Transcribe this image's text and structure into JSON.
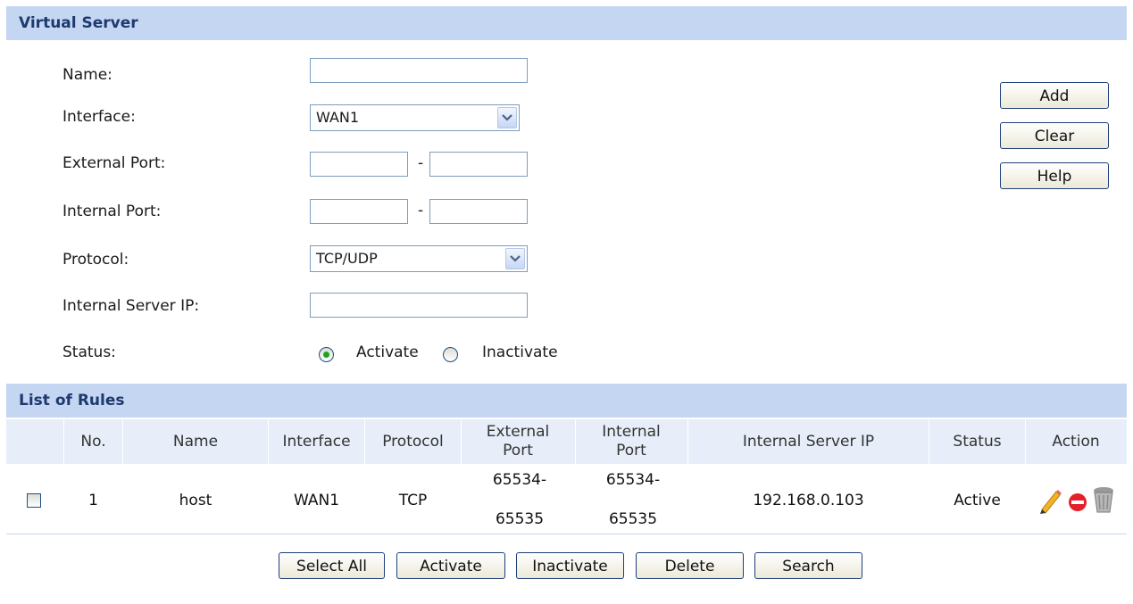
{
  "form": {
    "section_title": "Virtual Server",
    "name_label": "Name:",
    "name_value": "",
    "interface_label": "Interface:",
    "interface_value": "WAN1",
    "external_port_label": "External Port:",
    "external_port_from": "",
    "external_port_to": "",
    "internal_port_label": "Internal Port:",
    "internal_port_from": "",
    "internal_port_to": "",
    "port_separator": "-",
    "protocol_label": "Protocol:",
    "protocol_value": "TCP/UDP",
    "server_ip_label": "Internal Server IP:",
    "server_ip_value": "",
    "status_label": "Status:",
    "status_activate": "Activate",
    "status_inactivate": "Inactivate",
    "status_selected": "Activate"
  },
  "side_buttons": {
    "add": "Add",
    "clear": "Clear",
    "help": "Help"
  },
  "rules": {
    "section_title": "List of Rules",
    "headers": {
      "no": "No.",
      "name": "Name",
      "interface": "Interface",
      "protocol": "Protocol",
      "external_port": "External Port",
      "internal_port": "Internal Port",
      "server_ip": "Internal Server IP",
      "status": "Status",
      "action": "Action"
    },
    "rows": [
      {
        "no": "1",
        "name": "host",
        "interface": "WAN1",
        "protocol": "TCP",
        "external_port_line1": "65534-",
        "external_port_line2": "65535",
        "internal_port_line1": "65534-",
        "internal_port_line2": "65535",
        "server_ip": "192.168.0.103",
        "status": "Active",
        "actions": [
          "pencil-icon",
          "disable-icon",
          "trash-icon"
        ]
      }
    ]
  },
  "bottom_buttons": {
    "select_all": "Select All",
    "activate": "Activate",
    "inactivate": "Inactivate",
    "delete": "Delete",
    "search": "Search"
  },
  "colors": {
    "header_bg": "#c5d6f2",
    "table_header_bg": "#e7eef9",
    "header_text": "#1d3a6e",
    "border": "#7f9db9"
  }
}
